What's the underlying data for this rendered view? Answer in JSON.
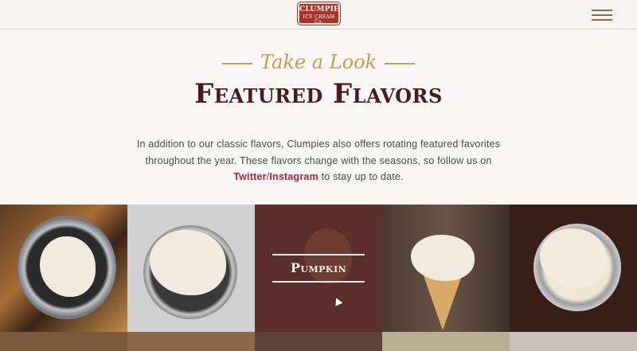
{
  "header": {
    "logo_line1": "CLUMPIES",
    "logo_line2": "ICE CREAM Co.",
    "menu_icon": "hamburger-menu-icon"
  },
  "intro": {
    "eyebrow": "Take a Look",
    "title": "Featured Flavors",
    "desc_part1": "In addition to our classic flavors, Clumpies also offers rotating featured favorites throughout the year. These flavors change with the seasons, so follow us on ",
    "link_twitter": "Twitter",
    "slash": "/",
    "link_instagram": "Instagram",
    "desc_part2": " to stay up to date."
  },
  "flavors": {
    "hover_label": "Pumpkin"
  },
  "colors": {
    "brand_red": "#a8322a",
    "gold": "#c69b4b",
    "title_maroon": "#4a1a1c",
    "link_red": "#b7232c"
  }
}
